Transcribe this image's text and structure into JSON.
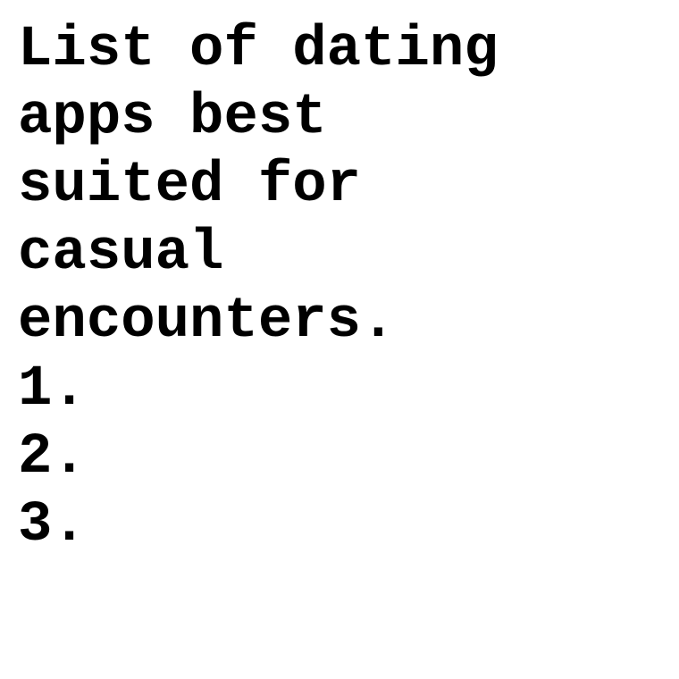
{
  "document": {
    "title_lines": [
      "List of dating",
      "apps best",
      "suited for",
      "casual",
      "encounters."
    ],
    "list_items": [
      "1.",
      "2.",
      "3."
    ]
  },
  "colors": {
    "background": "#ffffff",
    "text": "#000000"
  }
}
